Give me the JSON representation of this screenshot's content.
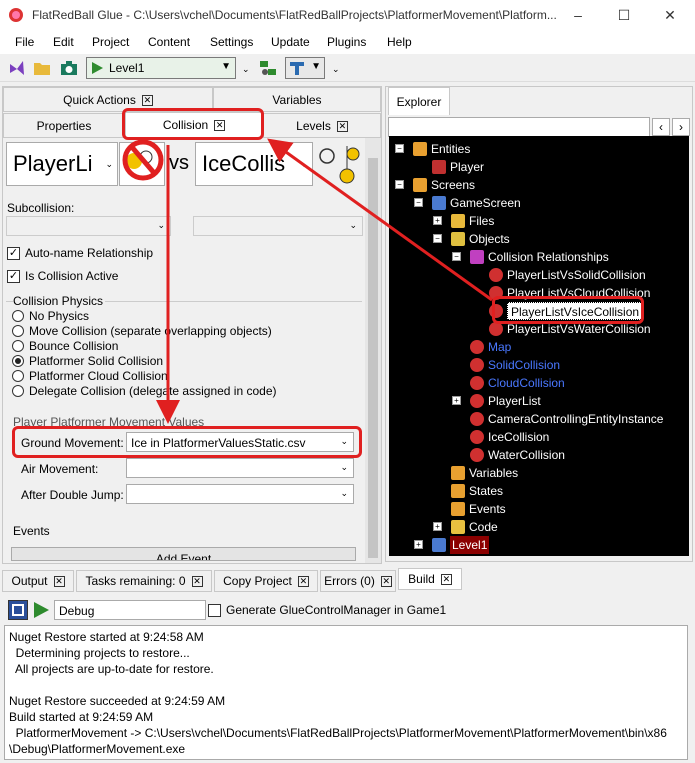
{
  "window": {
    "title": "FlatRedBall Glue - C:\\Users\\vchel\\Documents\\FlatRedBallProjects\\PlatformerMovement\\Platform...",
    "controls": [
      "–",
      "☐",
      "✕"
    ]
  },
  "menu": [
    "File",
    "Edit",
    "Project",
    "Content",
    "Settings",
    "Update",
    "Plugins",
    "Help"
  ],
  "toolbar": {
    "screen_combo": "Level1"
  },
  "left_tabs": {
    "row1": [
      {
        "label": "Quick Actions",
        "close": true
      },
      {
        "label": "Variables",
        "close": false
      }
    ],
    "row2": [
      {
        "label": "Properties",
        "close": false
      },
      {
        "label": "Collision",
        "close": true
      },
      {
        "label": "Levels",
        "close": true
      }
    ]
  },
  "collision": {
    "first_object": "PlayerLi",
    "vs": "vs",
    "second_object": "IceCollis",
    "subcollision_label": "Subcollision:",
    "auto_name": "Auto-name Relationship",
    "is_active": "Is Collision Active",
    "physics_title": "Collision Physics",
    "physics_options": [
      {
        "label": "No Physics",
        "selected": false
      },
      {
        "label": "Move Collision (separate overlapping objects)",
        "selected": false
      },
      {
        "label": "Bounce Collision",
        "selected": false
      },
      {
        "label": "Platformer Solid Collision",
        "selected": true
      },
      {
        "label": "Platformer Cloud Collision",
        "selected": false
      },
      {
        "label": "Delegate Collision (delegate assigned in code)",
        "selected": false
      }
    ],
    "movement_title": "Player Platformer Movement Values",
    "ground_label": "Ground Movement:",
    "ground_value": "Ice in PlatformerValuesStatic.csv",
    "air_label": "Air Movement:",
    "air_value": "",
    "double_jump_label": "After Double Jump:",
    "double_jump_value": "",
    "events_title": "Events",
    "add_event": "Add Event"
  },
  "explorer": {
    "tab": "Explorer",
    "search_value": "",
    "tree": [
      {
        "label": "Entities",
        "level": 0,
        "exp": "−",
        "icon": "entities-folder",
        "color": "#ffffff"
      },
      {
        "label": "Player",
        "level": 1,
        "exp": "",
        "icon": "entity",
        "color": "#ffffff"
      },
      {
        "label": "Screens",
        "level": 0,
        "exp": "−",
        "icon": "screens-folder",
        "color": "#ffffff"
      },
      {
        "label": "GameScreen",
        "level": 1,
        "exp": "−",
        "icon": "screen",
        "color": "#ffffff"
      },
      {
        "label": "Files",
        "level": 2,
        "exp": "+",
        "icon": "folder",
        "color": "#ffffff"
      },
      {
        "label": "Objects",
        "level": 2,
        "exp": "−",
        "icon": "objects",
        "color": "#ffffff"
      },
      {
        "label": "Collision Relationships",
        "level": 3,
        "exp": "−",
        "icon": "collision-group",
        "color": "#ffffff"
      },
      {
        "label": "PlayerListVsSolidCollision",
        "level": 4,
        "exp": "",
        "icon": "relationship",
        "color": "#ffffff"
      },
      {
        "label": "PlayerListVsCloudCollision",
        "level": 4,
        "exp": "",
        "icon": "relationship",
        "color": "#ffffff"
      },
      {
        "label": "PlayerListVsIceCollision",
        "level": 4,
        "exp": "",
        "icon": "relationship",
        "color": "#000000",
        "selected": true
      },
      {
        "label": "PlayerListVsWaterCollision",
        "level": 4,
        "exp": "",
        "icon": "relationship",
        "color": "#ffffff"
      },
      {
        "label": "Map",
        "level": 3,
        "exp": "",
        "icon": "object",
        "color": "#4a78ff"
      },
      {
        "label": "SolidCollision",
        "level": 3,
        "exp": "",
        "icon": "object",
        "color": "#4a78ff"
      },
      {
        "label": "CloudCollision",
        "level": 3,
        "exp": "",
        "icon": "object",
        "color": "#4a78ff"
      },
      {
        "label": "PlayerList",
        "level": 3,
        "exp": "+",
        "icon": "object",
        "color": "#ffffff"
      },
      {
        "label": "CameraControllingEntityInstance",
        "level": 3,
        "exp": "",
        "icon": "object",
        "color": "#ffffff"
      },
      {
        "label": "IceCollision",
        "level": 3,
        "exp": "",
        "icon": "object",
        "color": "#ffffff"
      },
      {
        "label": "WaterCollision",
        "level": 3,
        "exp": "",
        "icon": "object",
        "color": "#ffffff"
      },
      {
        "label": "Variables",
        "level": 2,
        "exp": "",
        "icon": "variables",
        "color": "#ffffff"
      },
      {
        "label": "States",
        "level": 2,
        "exp": "",
        "icon": "states",
        "color": "#ffffff"
      },
      {
        "label": "Events",
        "level": 2,
        "exp": "",
        "icon": "events",
        "color": "#ffffff"
      },
      {
        "label": "Code",
        "level": 2,
        "exp": "+",
        "icon": "code",
        "color": "#ffffff"
      },
      {
        "label": "Level1",
        "level": 1,
        "exp": "+",
        "icon": "screen",
        "color": "#ffffff",
        "highlight": true
      }
    ]
  },
  "bottom_tabs": [
    {
      "label": "Output",
      "close": true
    },
    {
      "label": "Tasks remaining: 0",
      "close": true
    },
    {
      "label": "Copy Project",
      "close": true
    },
    {
      "label": "Errors (0)",
      "close": true
    },
    {
      "label": "Build",
      "close": true,
      "active": true
    }
  ],
  "build": {
    "config": "Debug",
    "generate_label": "Generate GlueControlManager in Game1",
    "log": [
      "Nuget Restore started at 9:24:58 AM",
      "  Determining projects to restore...",
      "  All projects are up-to-date for restore.",
      "",
      "Nuget Restore succeeded at 9:24:59 AM",
      "Build started at 9:24:59 AM",
      "  PlatformerMovement -> C:\\Users\\vchel\\Documents\\FlatRedBallProjects\\PlatformerMovement\\PlatformerMovement\\bin\\x86",
      "\\Debug\\PlatformerMovement.exe"
    ]
  },
  "colors": {
    "annotation": "#e02020",
    "tree_bg": "#000000",
    "selection_bg": "#ffffff",
    "level_highlight": "#8b0000"
  }
}
